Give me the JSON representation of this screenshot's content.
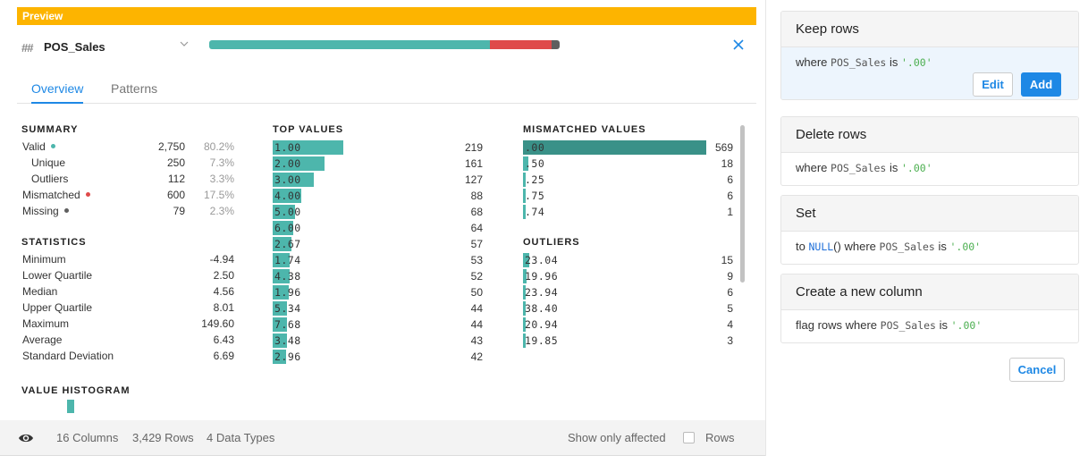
{
  "preview": {
    "label": "Preview"
  },
  "column": {
    "type_icon": "##",
    "name": "POS_Sales",
    "quality": {
      "valid_pct": 80.2,
      "mismatched_pct": 17.5,
      "missing_pct": 2.3
    },
    "colors": {
      "valid": "#4db6ac",
      "mismatched": "#df4a4a",
      "missing": "#5f5f5f",
      "accent": "#1e88e5",
      "preview": "#fdb400"
    }
  },
  "tabs": [
    {
      "label": "Overview",
      "active": true
    },
    {
      "label": "Patterns",
      "active": false
    }
  ],
  "summary": {
    "title": "SUMMARY",
    "rows": [
      {
        "label": "Valid",
        "count": "2,750",
        "pct": "80.2%",
        "dot": "valid",
        "indent": false
      },
      {
        "label": "Unique",
        "count": "250",
        "pct": "7.3%",
        "dot": null,
        "indent": true
      },
      {
        "label": "Outliers",
        "count": "112",
        "pct": "3.3%",
        "dot": null,
        "indent": true
      },
      {
        "label": "Mismatched",
        "count": "600",
        "pct": "17.5%",
        "dot": "mismatched",
        "indent": false
      },
      {
        "label": "Missing",
        "count": "79",
        "pct": "2.3%",
        "dot": "missing",
        "indent": false
      }
    ]
  },
  "statistics": {
    "title": "STATISTICS",
    "rows": [
      {
        "label": "Minimum",
        "value": "-4.94"
      },
      {
        "label": "Lower Quartile",
        "value": "2.50"
      },
      {
        "label": "Median",
        "value": "4.56"
      },
      {
        "label": "Upper Quartile",
        "value": "8.01"
      },
      {
        "label": "Maximum",
        "value": "149.60"
      },
      {
        "label": "Average",
        "value": "6.43"
      },
      {
        "label": "Standard Deviation",
        "value": "6.69"
      }
    ]
  },
  "histogram": {
    "title": "VALUE HISTOGRAM"
  },
  "top_values": {
    "title": "TOP VALUES",
    "items": [
      {
        "value": "1.00",
        "count": 219
      },
      {
        "value": "2.00",
        "count": 161
      },
      {
        "value": "3.00",
        "count": 127
      },
      {
        "value": "4.00",
        "count": 88
      },
      {
        "value": "5.00",
        "count": 68
      },
      {
        "value": "6.00",
        "count": 64
      },
      {
        "value": "2.67",
        "count": 57
      },
      {
        "value": "1.74",
        "count": 53
      },
      {
        "value": "4.38",
        "count": 52
      },
      {
        "value": "1.96",
        "count": 50
      },
      {
        "value": "5.34",
        "count": 44
      },
      {
        "value": "7.68",
        "count": 44
      },
      {
        "value": "3.48",
        "count": 43
      },
      {
        "value": "2.96",
        "count": 42
      }
    ]
  },
  "mismatched_values": {
    "title": "MISMATCHED VALUES",
    "items": [
      {
        "value": ".00",
        "count": 569,
        "selected": true
      },
      {
        "value": ".50",
        "count": 18,
        "selected": false
      },
      {
        "value": ".25",
        "count": 6,
        "selected": false
      },
      {
        "value": ".75",
        "count": 6,
        "selected": false
      },
      {
        "value": ".74",
        "count": 1,
        "selected": false
      }
    ]
  },
  "outliers": {
    "title": "OUTLIERS",
    "items": [
      {
        "value": "23.04",
        "count": 15
      },
      {
        "value": "19.96",
        "count": 9
      },
      {
        "value": "23.94",
        "count": 6
      },
      {
        "value": "38.40",
        "count": 5
      },
      {
        "value": "20.94",
        "count": 4
      },
      {
        "value": "19.85",
        "count": 3
      }
    ]
  },
  "footer": {
    "columns": "16 Columns",
    "rows": "3,429 Rows",
    "data_types": "4 Data Types",
    "show_only_affected": "Show only affected",
    "rows_checkbox_label": "Rows",
    "rows_checked": false
  },
  "suggestions": {
    "cards": [
      {
        "title": "Keep rows",
        "prefix": "where",
        "column": "POS_Sales",
        "op": "is",
        "literal": "'.00'",
        "selected": true
      },
      {
        "title": "Delete rows",
        "prefix": "where",
        "column": "POS_Sales",
        "op": "is",
        "literal": "'.00'",
        "selected": false
      },
      {
        "title": "Set",
        "prefix_a": "to",
        "fn": "NULL",
        "fn_suffix": "()",
        "prefix": "where",
        "column": "POS_Sales",
        "op": "is",
        "literal": "'.00'",
        "selected": false
      },
      {
        "title": "Create a new column",
        "prefix": "flag rows where",
        "column": "POS_Sales",
        "op": "is",
        "literal": "'.00'",
        "selected": false
      }
    ],
    "edit_label": "Edit",
    "add_label": "Add",
    "cancel_label": "Cancel"
  }
}
